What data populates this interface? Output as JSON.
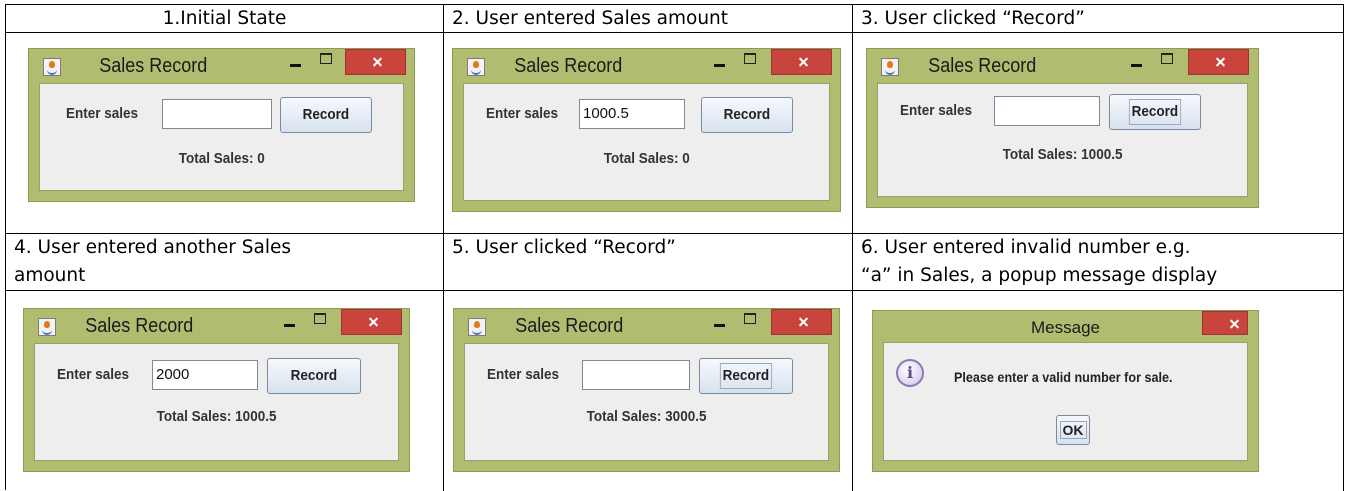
{
  "headers": [
    "1.Initial State",
    "2. User entered Sales amount",
    "3. User clicked “Record”",
    "4. User entered another Sales amount",
    "5. User clicked “Record”",
    "6. User entered invalid number e.g. “a” in Sales, a popup message display"
  ],
  "header_lines": {
    "h4_line1": "4. User entered another Sales",
    "h4_line2": "amount",
    "h6_line1": "6. User entered invalid number e.g.",
    "h6_line2": "“a” in Sales, a popup message display"
  },
  "sales_window": {
    "title": "Sales Record",
    "label": "Enter sales",
    "button": "Record",
    "title_icon": "java-cup-icon"
  },
  "states": [
    {
      "input": "",
      "total": "Total Sales: 0"
    },
    {
      "input": "1000.5",
      "total": "Total Sales: 0"
    },
    {
      "input": "",
      "total": "Total Sales: 1000.5"
    },
    {
      "input": "2000",
      "total": "Total Sales: 1000.5"
    },
    {
      "input": "",
      "total": "Total Sales: 3000.5"
    }
  ],
  "message_dialog": {
    "title": "Message",
    "text": "Please enter a valid number for sale.",
    "ok": "OK",
    "icon": "info-icon"
  },
  "colors": {
    "window_frame": "#b2bc70",
    "close_button": "#c9443c",
    "content_bg": "#eeeeee"
  }
}
